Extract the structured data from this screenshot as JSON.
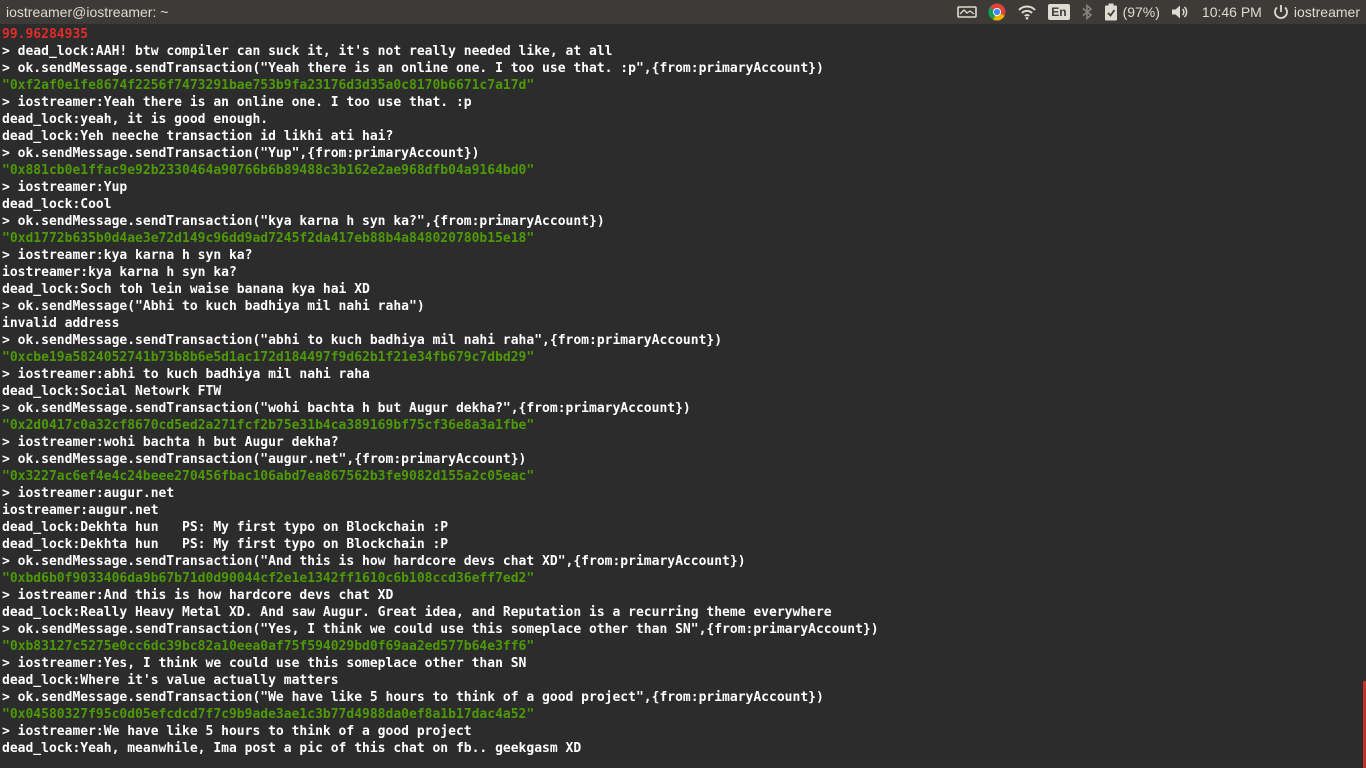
{
  "topbar": {
    "window_title": "iostreamer@iostreamer: ~",
    "indicators": {
      "keyboard_layout": "En",
      "battery_percent": "(97%)",
      "time": "10:46 PM",
      "user": "iostreamer"
    }
  },
  "colors": {
    "panel_bg": "#3c3b37",
    "terminal_bg": "#2c2c2c",
    "text_white": "#ffffff",
    "text_green": "#4e9a06",
    "text_red": "#e32b2b"
  },
  "terminal": {
    "lines": [
      {
        "text": "99.96284935",
        "color": "red"
      },
      {
        "text": "> dead_lock:AAH! btw compiler can suck it, it's not really needed like, at all",
        "color": "white"
      },
      {
        "text": "> ok.sendMessage.sendTransaction(\"Yeah there is an online one. I too use that. :p\",{from:primaryAccount})",
        "color": "white"
      },
      {
        "text": "\"0xf2af0e1fe8674f2256f7473291bae753b9fa23176d3d35a0c8170b6671c7a17d\"",
        "color": "green"
      },
      {
        "text": "> iostreamer:Yeah there is an online one. I too use that. :p",
        "color": "white"
      },
      {
        "text": "dead_lock:yeah, it is good enough.",
        "color": "white"
      },
      {
        "text": "dead_lock:Yeh neeche transaction id likhi ati hai?",
        "color": "white"
      },
      {
        "text": "> ok.sendMessage.sendTransaction(\"Yup\",{from:primaryAccount})",
        "color": "white"
      },
      {
        "text": "\"0x881cb0e1ffac9e92b2330464a90766b6b89488c3b162e2ae968dfb04a9164bd0\"",
        "color": "green"
      },
      {
        "text": "> iostreamer:Yup",
        "color": "white"
      },
      {
        "text": "dead_lock:Cool",
        "color": "white"
      },
      {
        "text": "> ok.sendMessage.sendTransaction(\"kya karna h syn ka?\",{from:primaryAccount})",
        "color": "white"
      },
      {
        "text": "\"0xd1772b635b0d4ae3e72d149c96dd9ad7245f2da417eb88b4a848020780b15e18\"",
        "color": "green"
      },
      {
        "text": "> iostreamer:kya karna h syn ka?",
        "color": "white"
      },
      {
        "text": "iostreamer:kya karna h syn ka?",
        "color": "white"
      },
      {
        "text": "dead_lock:Soch toh lein waise banana kya hai XD",
        "color": "white"
      },
      {
        "text": "> ok.sendMessage(\"Abhi to kuch badhiya mil nahi raha\")",
        "color": "white"
      },
      {
        "text": "invalid address",
        "color": "white"
      },
      {
        "text": "> ok.sendMessage.sendTransaction(\"abhi to kuch badhiya mil nahi raha\",{from:primaryAccount})",
        "color": "white"
      },
      {
        "text": "\"0xcbe19a5824052741b73b8b6e5d1ac172d184497f9d62b1f21e34fb679c7dbd29\"",
        "color": "green"
      },
      {
        "text": "> iostreamer:abhi to kuch badhiya mil nahi raha",
        "color": "white"
      },
      {
        "text": "dead_lock:Social Netowrk FTW",
        "color": "white"
      },
      {
        "text": "> ok.sendMessage.sendTransaction(\"wohi bachta h but Augur dekha?\",{from:primaryAccount})",
        "color": "white"
      },
      {
        "text": "\"0x2d0417c0a32cf8670cd5ed2a271fcf2b75e31b4ca389169bf75cf36e8a3a1fbe\"",
        "color": "green"
      },
      {
        "text": "> iostreamer:wohi bachta h but Augur dekha?",
        "color": "white"
      },
      {
        "text": "> ok.sendMessage.sendTransaction(\"augur.net\",{from:primaryAccount})",
        "color": "white"
      },
      {
        "text": "\"0x3227ac6ef4e4c24beee270456fbac106abd7ea867562b3fe9082d155a2c05eac\"",
        "color": "green"
      },
      {
        "text": "> iostreamer:augur.net",
        "color": "white"
      },
      {
        "text": "iostreamer:augur.net",
        "color": "white"
      },
      {
        "text": "dead_lock:Dekhta hun   PS: My first typo on Blockchain :P",
        "color": "white"
      },
      {
        "text": "dead_lock:Dekhta hun   PS: My first typo on Blockchain :P",
        "color": "white"
      },
      {
        "text": "> ok.sendMessage.sendTransaction(\"And this is how hardcore devs chat XD\",{from:primaryAccount})",
        "color": "white"
      },
      {
        "text": "\"0xbd6b0f9033406da9b67b71d0d90044cf2e1e1342ff1610c6b108ccd36eff7ed2\"",
        "color": "green"
      },
      {
        "text": "> iostreamer:And this is how hardcore devs chat XD",
        "color": "white"
      },
      {
        "text": "dead_lock:Really Heavy Metal XD. And saw Augur. Great idea, and Reputation is a recurring theme everywhere",
        "color": "white"
      },
      {
        "text": "> ok.sendMessage.sendTransaction(\"Yes, I think we could use this someplace other than SN\",{from:primaryAccount})",
        "color": "white"
      },
      {
        "text": "\"0xb83127c5275e0cc6dc39bc82a10eea0af75f594029bd0f69aa2ed577b64e3ff6\"",
        "color": "green"
      },
      {
        "text": "> iostreamer:Yes, I think we could use this someplace other than SN",
        "color": "white"
      },
      {
        "text": "dead_lock:Where it's value actually matters",
        "color": "white"
      },
      {
        "text": "> ok.sendMessage.sendTransaction(\"We have like 5 hours to think of a good project\",{from:primaryAccount})",
        "color": "white"
      },
      {
        "text": "\"0x04580327f95c0d05efcdcd7f7c9b9ade3ae1c3b77d4988da0ef8a1b17dac4a52\"",
        "color": "green"
      },
      {
        "text": "> iostreamer:We have like 5 hours to think of a good project",
        "color": "white"
      },
      {
        "text": "dead_lock:Yeah, meanwhile, Ima post a pic of this chat on fb.. geekgasm XD",
        "color": "white"
      }
    ]
  }
}
